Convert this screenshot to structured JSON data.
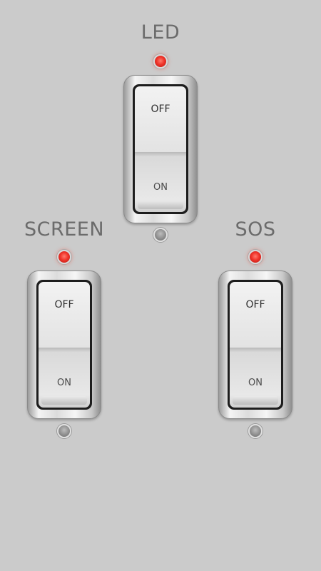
{
  "switches": [
    {
      "id": "led",
      "title": "LED",
      "off_label": "OFF",
      "on_label": "ON",
      "state": "off",
      "indicator_color": "#f0342a"
    },
    {
      "id": "screen",
      "title": "SCREEN",
      "off_label": "OFF",
      "on_label": "ON",
      "state": "off",
      "indicator_color": "#f0342a"
    },
    {
      "id": "sos",
      "title": "SOS",
      "off_label": "OFF",
      "on_label": "ON",
      "state": "off",
      "indicator_color": "#f0342a"
    }
  ],
  "colors": {
    "background": "#cbcbcb",
    "title_text": "#6b6b6b",
    "indicator_on": "#f0342a",
    "indicator_off": "#8f8f8f"
  }
}
